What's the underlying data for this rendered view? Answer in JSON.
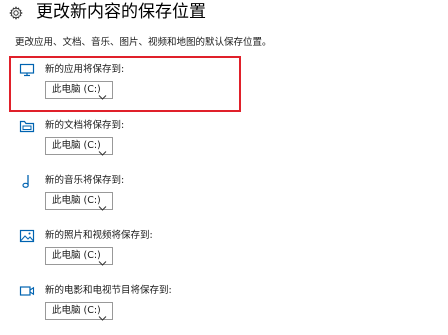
{
  "header": {
    "title": "更改新内容的保存位置",
    "icon": "gear-icon"
  },
  "description": "更改应用、文档、音乐、图片、视频和地图的默认保存位置。",
  "sections": [
    {
      "label": "新的应用将保存到:",
      "value": "此电脑 (C:)",
      "icon": "monitor-icon"
    },
    {
      "label": "新的文档将保存到:",
      "value": "此电脑 (C:)",
      "icon": "folder-icon"
    },
    {
      "label": "新的音乐将保存到:",
      "value": "此电脑 (C:)",
      "icon": "music-note-icon"
    },
    {
      "label": "新的照片和视频将保存到:",
      "value": "此电脑 (C:)",
      "icon": "picture-icon"
    },
    {
      "label": "新的电影和电视节目将保存到:",
      "value": "此电脑 (C:)",
      "icon": "video-camera-icon"
    }
  ],
  "colors": {
    "accent": "#0063b1",
    "highlight": "#e0202a"
  }
}
